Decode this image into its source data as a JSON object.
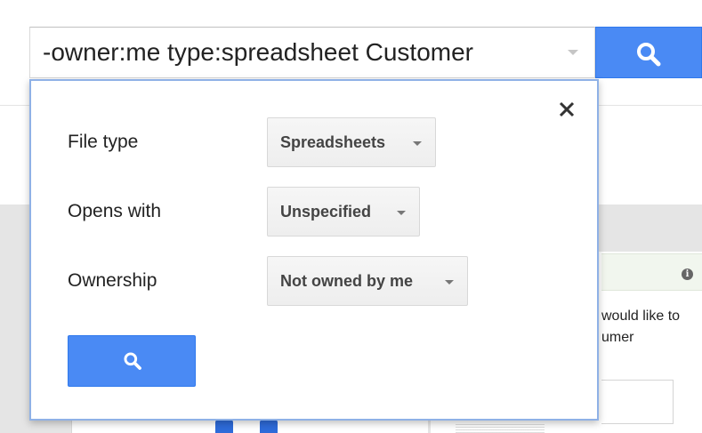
{
  "search": {
    "query": "-owner:me type:spreadsheet Customer"
  },
  "popup": {
    "rows": [
      {
        "label": "File type",
        "value": "Spreadsheets"
      },
      {
        "label": "Opens with",
        "value": "Unspecified"
      },
      {
        "label": "Ownership",
        "value": "Not owned by me"
      }
    ]
  },
  "background": {
    "text_line1": "would like to",
    "text_line2": "umer",
    "info_icon": "i"
  },
  "colors": {
    "accent_blue": "#4a8af4",
    "popup_border": "#8fb1e6"
  },
  "icons": {
    "search": "search-icon",
    "close": "close-icon",
    "dropdown": "chevron-down-icon",
    "info": "info-icon"
  }
}
